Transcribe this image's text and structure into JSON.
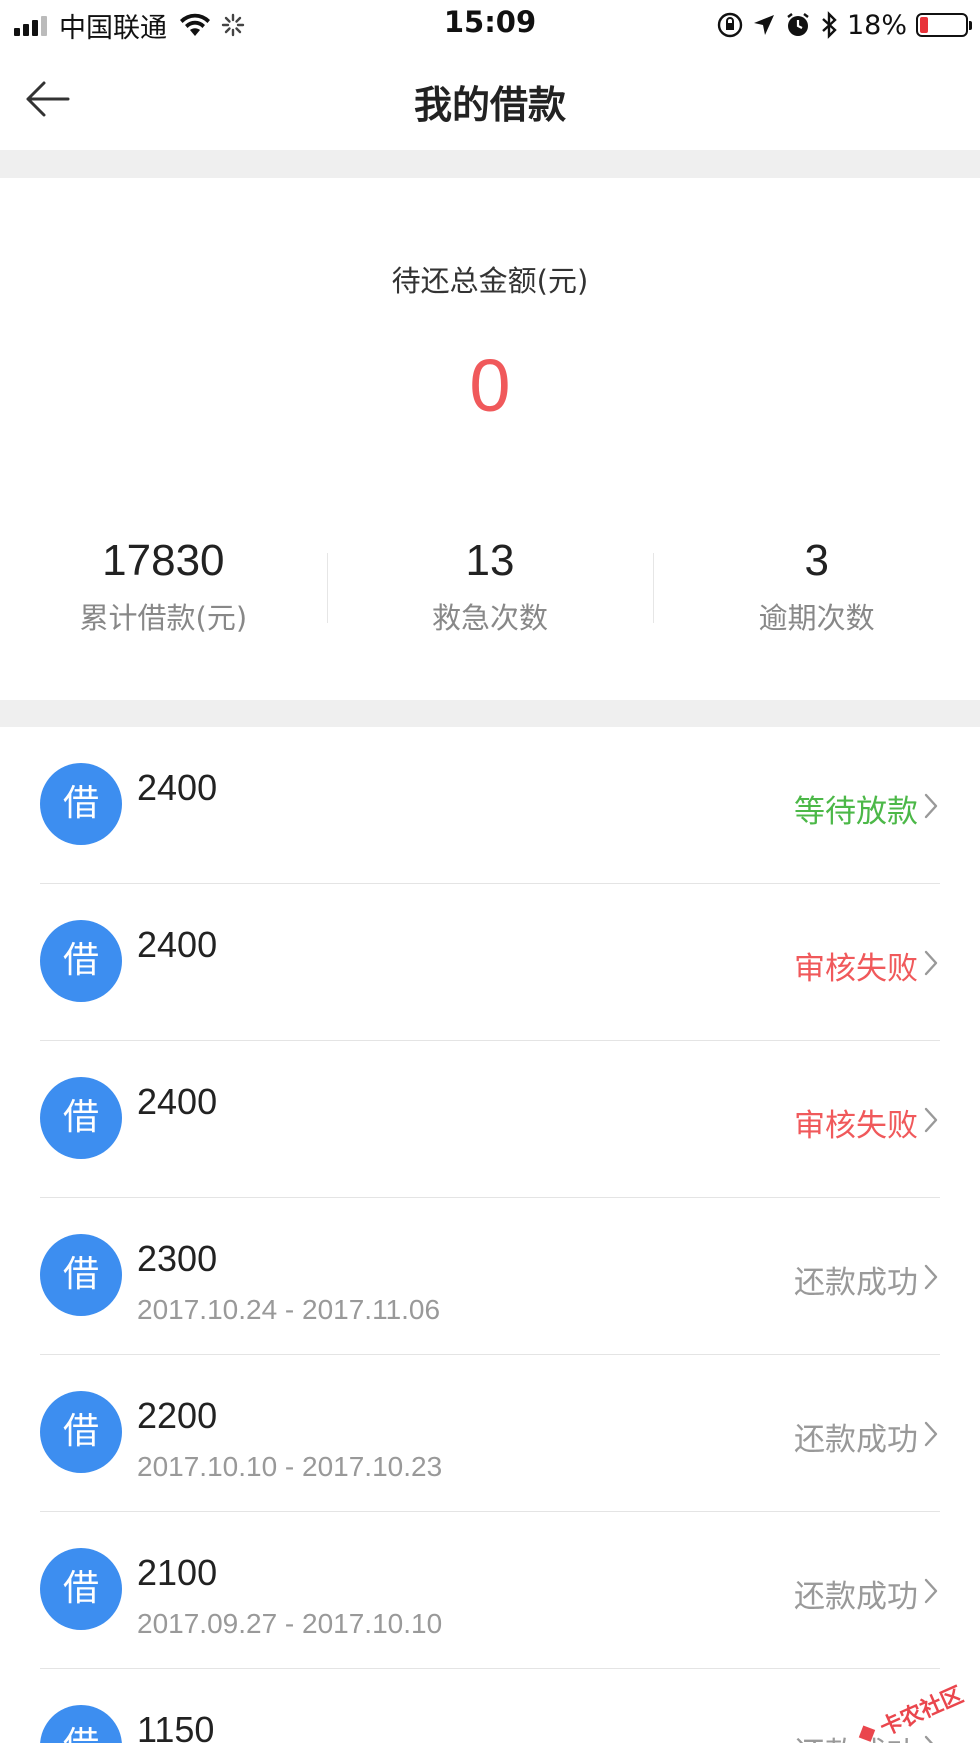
{
  "status_bar": {
    "carrier": "中国联通",
    "time": "15:09",
    "battery": "18%",
    "battery_level": 0.18,
    "icons": [
      "signal-icon",
      "wifi-icon",
      "loading-icon",
      "orientation-lock-icon",
      "location-icon",
      "alarm-icon",
      "bluetooth-icon",
      "battery-icon"
    ]
  },
  "nav": {
    "title": "我的借款",
    "back_icon": "arrow-left-icon"
  },
  "summary": {
    "label": "待还总金额(元)",
    "amount": "0",
    "amount_color": "#f0595b",
    "stats": [
      {
        "value": "17830",
        "label": "累计借款(元)"
      },
      {
        "value": "13",
        "label": "救急次数"
      },
      {
        "value": "3",
        "label": "逾期次数"
      }
    ]
  },
  "loans": [
    {
      "badge": "借",
      "amount": "2400",
      "period": "",
      "status": "等待放款",
      "status_color": "#4cb848"
    },
    {
      "badge": "借",
      "amount": "2400",
      "period": "",
      "status": "审核失败",
      "status_color": "#f0595b"
    },
    {
      "badge": "借",
      "amount": "2400",
      "period": "",
      "status": "审核失败",
      "status_color": "#f0595b"
    },
    {
      "badge": "借",
      "amount": "2300",
      "period": "2017.10.24 - 2017.11.06",
      "status": "还款成功",
      "status_color": "#999999"
    },
    {
      "badge": "借",
      "amount": "2200",
      "period": "2017.10.10 - 2017.10.23",
      "status": "还款成功",
      "status_color": "#999999"
    },
    {
      "badge": "借",
      "amount": "2100",
      "period": "2017.09.27 - 2017.10.10",
      "status": "还款成功",
      "status_color": "#999999"
    },
    {
      "badge": "借",
      "amount": "1150",
      "period": "",
      "status": "还款成功",
      "status_color": "#999999"
    }
  ],
  "colors": {
    "badge_blue": "#3d8ef0",
    "divider_gray": "#efefef"
  },
  "watermark": "卡农社区"
}
